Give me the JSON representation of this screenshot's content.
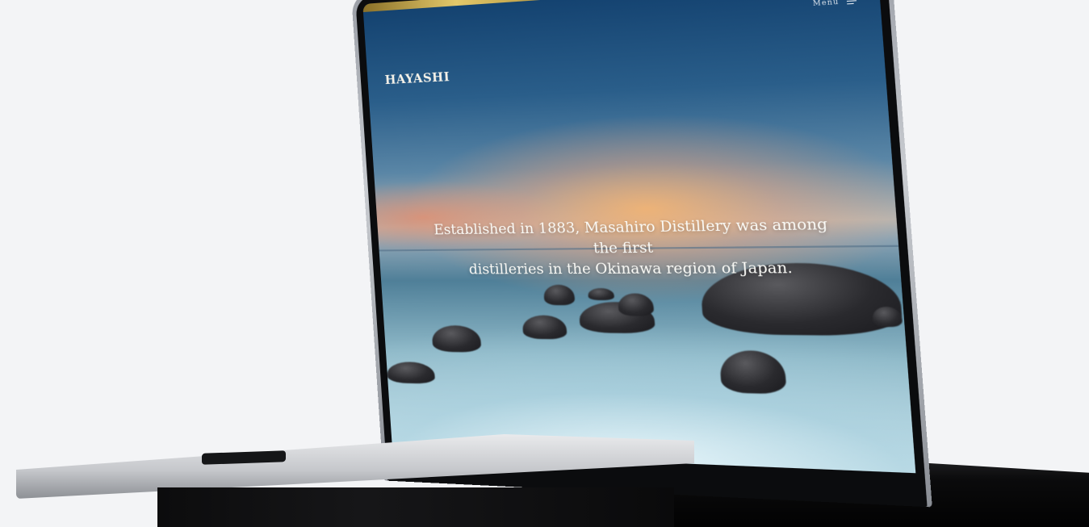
{
  "site": {
    "brand": "HAYASHI",
    "menu_label": "Menu",
    "hero_line_1": "Established in 1883, Masahiro Distillery was among the first",
    "hero_line_2": "distilleries in the Okinawa region of Japan."
  },
  "icons": {
    "menu": "hamburger-menu-icon"
  },
  "colors": {
    "background": "#f3f4f6",
    "gold_accent": "#e3c86a",
    "hero_text": "#fbfbf7",
    "sky_top": "#12406e",
    "fog": "#cde4ea"
  }
}
